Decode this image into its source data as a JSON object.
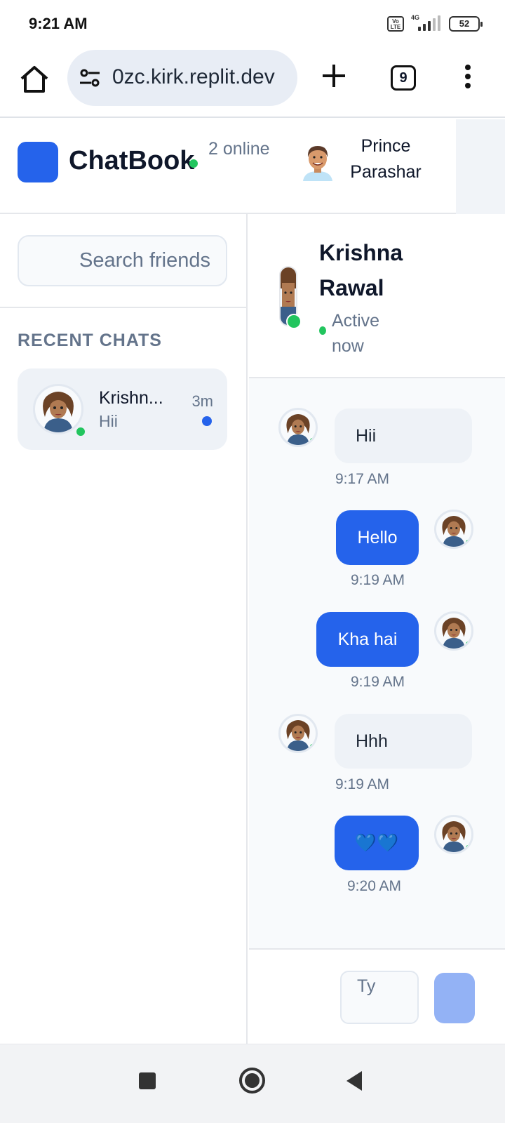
{
  "status_bar": {
    "time": "9:21 AM",
    "volte": "Vo LTE",
    "network": "4G",
    "battery": "52"
  },
  "browser": {
    "url": "0zc.kirk.replit.dev",
    "tab_count": "9",
    "icons": [
      "home-icon",
      "site-settings-icon",
      "plus-icon",
      "tabs-icon",
      "more-vert-icon"
    ]
  },
  "app": {
    "brand": "ChatBook",
    "online_count": "2 online",
    "user_name": "Prince Parashar",
    "accent_color": "#2563eb"
  },
  "sidebar": {
    "search_placeholder": "Search friends",
    "section_label": "RECENT CHATS",
    "chats": [
      {
        "name": "Krishn...",
        "preview": "Hii",
        "time": "3m",
        "unread": true,
        "online": true
      }
    ]
  },
  "chat": {
    "peer_name": "Krishna Rawal",
    "peer_status": "Active now",
    "messages": [
      {
        "direction": "in",
        "text": "Hii",
        "time": "9:17 AM"
      },
      {
        "direction": "out",
        "text": "Hello",
        "time": "9:19 AM"
      },
      {
        "direction": "out",
        "text": "Kha hai",
        "time": "9:19 AM"
      },
      {
        "direction": "in",
        "text": "Hhh",
        "time": "9:19 AM"
      },
      {
        "direction": "out",
        "text": "💙💙",
        "time": "9:20 AM"
      }
    ],
    "composer_placeholder": "Ty"
  },
  "nav": {
    "buttons": [
      "recents-button",
      "home-button",
      "back-button"
    ]
  }
}
